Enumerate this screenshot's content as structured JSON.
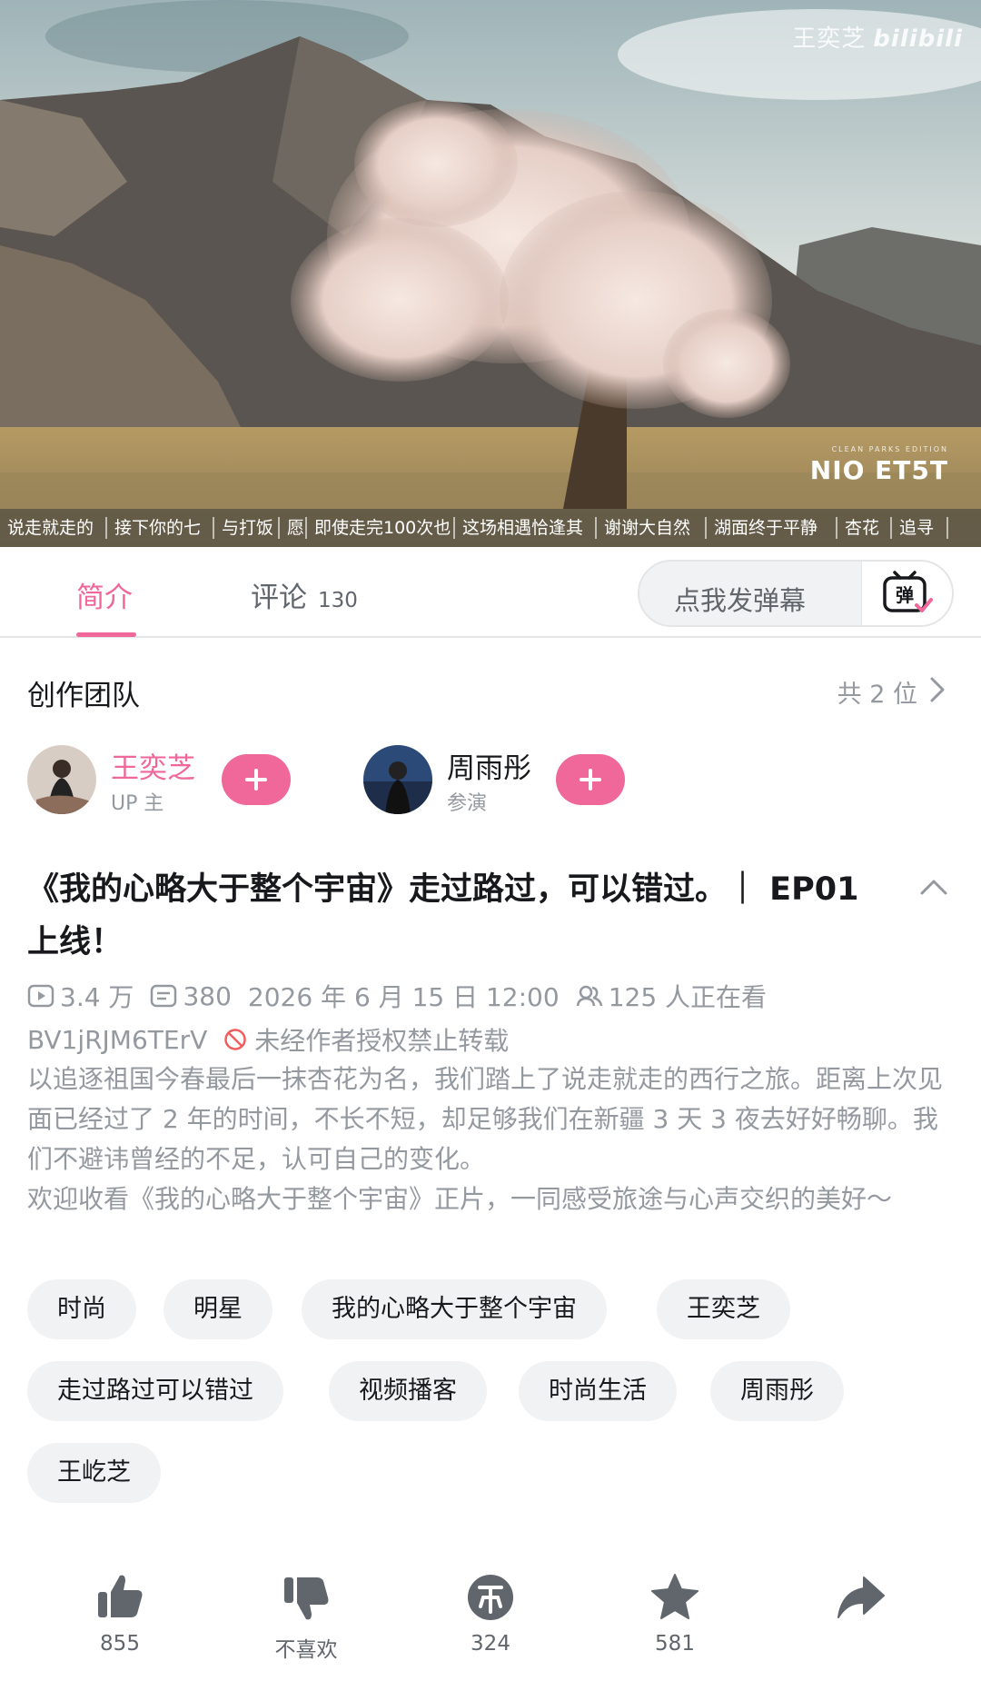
{
  "video": {
    "watermark_name": "王奕芝",
    "watermark_brand": "bilibili",
    "sponsor_logo": "NIO ET5T",
    "sponsor_small": "CLEAN PARKS EDITION",
    "danmaku": [
      "说走就走的",
      "接下你的七",
      "与打饭",
      "愿",
      "即使走完100次也",
      "这场相遇恰逢其",
      "谢谢大自然",
      "湖面终于平静",
      "杏花",
      "追寻"
    ]
  },
  "tabs": {
    "intro": "简介",
    "comments": "评论",
    "comments_count": "130",
    "danmaku_placeholder": "点我发弹幕",
    "danmaku_icon": "danmaku-tv-icon"
  },
  "team": {
    "title": "创作团队",
    "count": "共 2 位",
    "members": [
      {
        "name": "王奕芝",
        "role": "UP 主"
      },
      {
        "name": "周雨彤",
        "role": "参演"
      }
    ]
  },
  "video_info": {
    "title": "《我的心略大于整个宇宙》走过路过，可以错过。｜ EP01 上线！",
    "views": "3.4 万",
    "danmaku_count": "380",
    "date": "2026 年 6 月 15 日 12:00",
    "watching": "125 人正在看",
    "bvid": "BV1jRJM6TErV",
    "copyright": "未经作者授权禁止转载",
    "description": "以追逐祖国今春最后一抹杏花为名，我们踏上了说走就走的西行之旅。距离上次见面已经过了 2 年的时间，不长不短，却足够我们在新疆 3 天 3 夜去好好畅聊。我们不避讳曾经的不足，认可自己的变化。\n欢迎收看《我的心略大于整个宇宙》正片，一同感受旅途与心声交织的美好～"
  },
  "tags": [
    "时尚",
    "明星",
    "我的心略大于整个宇宙",
    "王奕芝",
    "走过路过可以错过",
    "视频播客",
    "时尚生活",
    "周雨彤",
    "王屹芝"
  ],
  "actions": {
    "like": "855",
    "dislike": "不喜欢",
    "coin": "324",
    "favorite": "581"
  },
  "colors": {
    "accent": "#f0679a",
    "muted_text": "#9499a0",
    "tag_bg": "#f1f2f3"
  }
}
